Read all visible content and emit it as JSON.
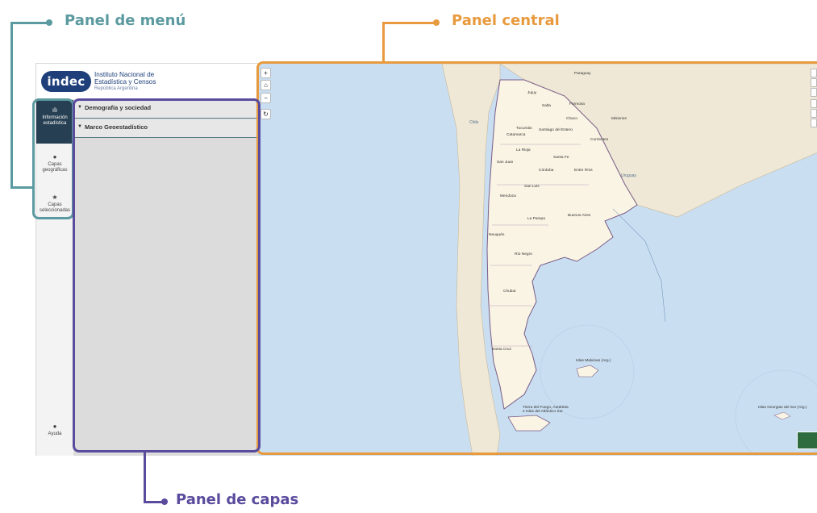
{
  "annotations": {
    "menu_panel": "Panel de menú",
    "central_panel": "Panel central",
    "layers_panel": "Panel de capas"
  },
  "colors": {
    "menu_accent": "#5b9aa0",
    "central_accent": "#e89a3e",
    "layers_accent": "#5a4b9d",
    "rail_active": "#263f52",
    "logo": "#1e3f7a"
  },
  "header": {
    "logo_text": "indec",
    "org_line1": "Instituto Nacional de",
    "org_line2": "Estadística y Censos",
    "country": "República Argentina"
  },
  "menu": {
    "items": [
      {
        "icon": "bar-chart-icon",
        "glyph": "ılı",
        "label": "Información estadística",
        "active": true
      },
      {
        "icon": "globe-icon",
        "glyph": "●",
        "label": "Capas geográficas",
        "active": false
      },
      {
        "icon": "star-icon",
        "glyph": "★",
        "label": "Capas seleccionadas",
        "active": false
      }
    ],
    "help": {
      "icon": "help-icon",
      "glyph": "●",
      "label": "Ayuda"
    }
  },
  "layers": {
    "groups": [
      {
        "label": "Demografía y sociedad"
      },
      {
        "label": "Marco Geoestadístico"
      }
    ]
  },
  "map": {
    "controls": {
      "zoom_in": "+",
      "home": "⌂",
      "zoom_out": "−",
      "reset": "↻"
    },
    "labels": {
      "paraguay": "Paraguay",
      "chile": "Chile",
      "uruguay": "Uruguay",
      "jujuy": "Jujuy",
      "salta": "Salta",
      "formosa": "Formosa",
      "chaco": "Chaco",
      "tucuman": "Tucumán",
      "catamarca": "Catamarca",
      "santiago": "Santiago del Estero",
      "misiones": "Misiones",
      "corrientes": "Corrientes",
      "la_rioja": "La Rioja",
      "santa_fe": "Santa Fe",
      "san_juan": "San Juan",
      "cordoba": "Córdoba",
      "entre_rios": "Entre Ríos",
      "san_luis": "San Luis",
      "mendoza": "Mendoza",
      "buenos_aires": "Buenos Aires",
      "la_pampa": "La Pampa",
      "neuquen": "Neuquén",
      "rio_negro": "Río Negro",
      "chubut": "Chubut",
      "santa_cruz": "Santa Cruz",
      "malvinas": "Islas Malvinas (Arg.)",
      "georgias": "Islas Georgias del Sur (Arg.)",
      "tierra_fuego": "Tierra del Fuego, Antártida e Islas del Atlántico Sur"
    }
  }
}
